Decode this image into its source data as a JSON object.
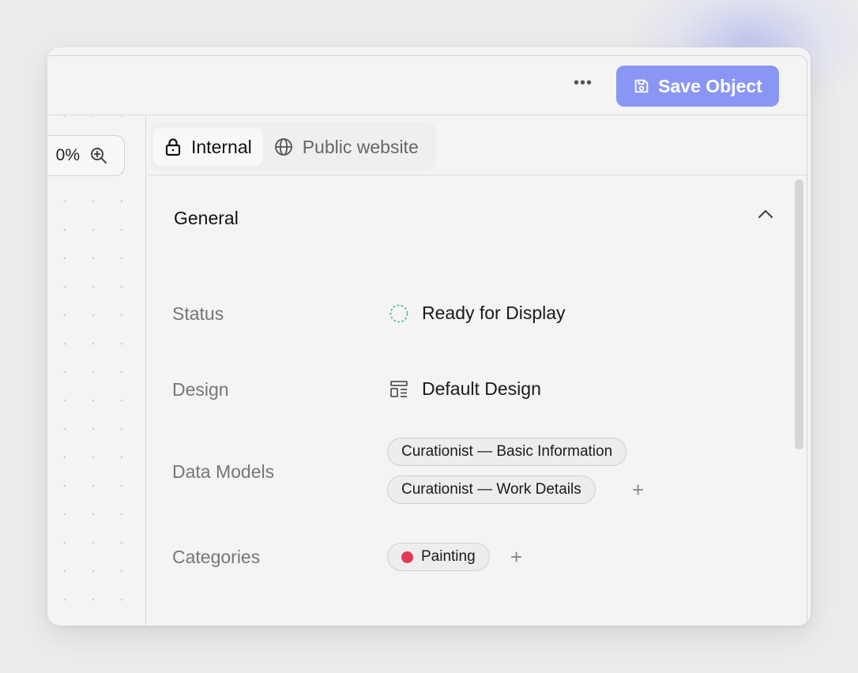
{
  "toolbar": {
    "more_label": "•••",
    "save_label": "Save Object",
    "save_color": "#8a96f4"
  },
  "canvas": {
    "zoom_value": "0%"
  },
  "tabs": [
    {
      "label": "Internal",
      "icon": "lock-icon",
      "active": true
    },
    {
      "label": "Public website",
      "icon": "globe-icon",
      "active": false
    }
  ],
  "section": {
    "title": "General",
    "fields": {
      "status": {
        "label": "Status",
        "value": "Ready for Display",
        "icon": "dashed-circle-icon",
        "icon_color": "#3fbf8f"
      },
      "design": {
        "label": "Design",
        "value": "Default Design",
        "icon": "layout-icon"
      },
      "data_models": {
        "label": "Data Models",
        "items": [
          "Curationist — Basic Information",
          "Curationist — Work Details"
        ],
        "add_label": "+"
      },
      "categories": {
        "label": "Categories",
        "items": [
          {
            "label": "Painting",
            "color": "#e23a55"
          }
        ],
        "add_label": "+"
      }
    }
  }
}
